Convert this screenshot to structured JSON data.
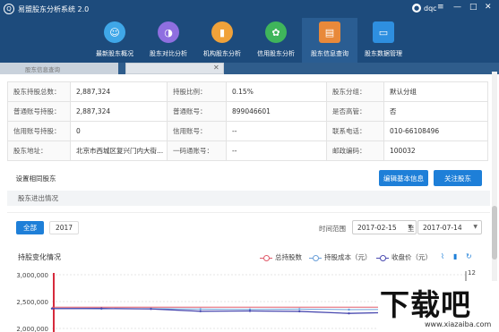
{
  "app": {
    "title": "易盟股东分析系统 2.0",
    "user": "dqc"
  },
  "nav": [
    "最新股东概况",
    "股东对比分析",
    "机构股东分析",
    "信用股东分析",
    "股东信息查询",
    "股东数据管理"
  ],
  "tabs": {
    "active": "股东信息查询"
  },
  "info": {
    "rows": [
      [
        {
          "label": "股东持股总数：",
          "value": "2,887,324"
        },
        {
          "label": "持股比例：",
          "value": "0.15%"
        },
        {
          "label": "股东分组：",
          "value": "默认分组"
        }
      ],
      [
        {
          "label": "普通账号持股：",
          "value": "2,887,324"
        },
        {
          "label": "普通账号：",
          "value": "899046601"
        },
        {
          "label": "是否高管：",
          "value": "否"
        }
      ],
      [
        {
          "label": "信用账号持股：",
          "value": "0"
        },
        {
          "label": "信用账号：",
          "value": "--"
        },
        {
          "label": "联系电话：",
          "value": "010-66108496"
        }
      ],
      [
        {
          "label": "股东地址：",
          "value": "北京市西城区复兴门内大街..."
        },
        {
          "label": "一码通账号：",
          "value": "--"
        },
        {
          "label": "邮政编码：",
          "value": "100032"
        }
      ]
    ]
  },
  "buttons": {
    "related": "设置相同股东",
    "edit": "编辑基本信息",
    "follow": "关注股东"
  },
  "section": {
    "title": "股东进出情况"
  },
  "filter": {
    "all": "全部",
    "year": "2017",
    "range_label": "时间范围",
    "start": "2017-02-15",
    "to": "至",
    "end": "2017-07-14"
  },
  "chart_data": {
    "type": "line",
    "title": "持股变化情况",
    "legend": [
      "总持股数",
      "持股成本（元）",
      "收盘价（元）"
    ],
    "y_left_ticks": [
      "3,000,000",
      "2,500,000",
      "2,000,000"
    ],
    "y_right_ticks": [
      "12"
    ],
    "ylim": [
      2000000,
      3000000
    ],
    "series": [
      {
        "name": "总持股数",
        "values": [
          2395000,
          2395000,
          2395000,
          2395000,
          2395000,
          2395000,
          2395000,
          2395000,
          2395000
        ]
      },
      {
        "name": "持股成本（元）",
        "values": [
          2370000,
          2365000,
          2368000,
          2360000,
          2355000,
          2360000,
          2350000,
          2355000,
          2352000
        ]
      },
      {
        "name": "收盘价（元）",
        "values": [
          2370000,
          2372000,
          2362000,
          2320000,
          2325000,
          2318000,
          2280000,
          2300000,
          2270000
        ]
      }
    ],
    "colors": [
      "#e05a6a",
      "#6a9fd8",
      "#4a4ab0"
    ]
  },
  "watermark": {
    "big": "下载吧",
    "small": "www.xiazaiba.com"
  }
}
